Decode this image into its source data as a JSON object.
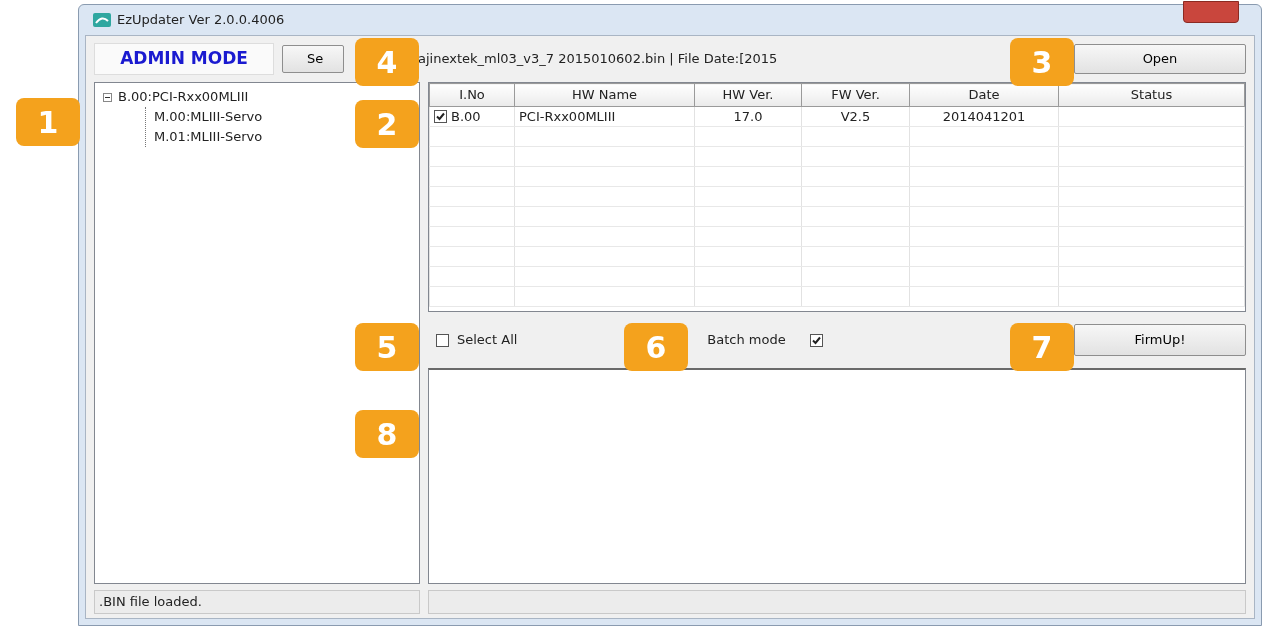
{
  "window": {
    "title": "EzUpdater Ver 2.0.0.4006"
  },
  "mode_label": "ADMIN MODE",
  "select_button": "Se",
  "file_info": "ajinextek_ml03_v3_7 2015010602.bin | File Date:[2015",
  "open_button": "Open",
  "tree": [
    {
      "label": "B.00:PCI-Rxx00MLIII",
      "expanded": true,
      "children": [
        {
          "label": "M.00:MLIII-Servo"
        },
        {
          "label": "M.01:MLIII-Servo"
        }
      ]
    }
  ],
  "table": {
    "columns": [
      "I.No",
      "HW Name",
      "HW Ver.",
      "FW Ver.",
      "Date",
      "Status"
    ],
    "rows": [
      {
        "checked": true,
        "cells": [
          "B.00",
          "PCI-Rxx00MLIII",
          "17.0",
          "V2.5",
          "2014041201"
        ]
      }
    ]
  },
  "select_all": {
    "label": "Select All",
    "checked": false
  },
  "batch_mode": {
    "label": "Batch mode",
    "checked": true
  },
  "firmup_button": "FirmUp!",
  "status_bar": {
    "text": ".BIN file loaded."
  },
  "callouts": [
    {
      "number": "1"
    },
    {
      "number": "2"
    },
    {
      "number": "3"
    },
    {
      "number": "4"
    },
    {
      "number": "5"
    },
    {
      "number": "6"
    },
    {
      "number": "7"
    },
    {
      "number": "8"
    }
  ]
}
